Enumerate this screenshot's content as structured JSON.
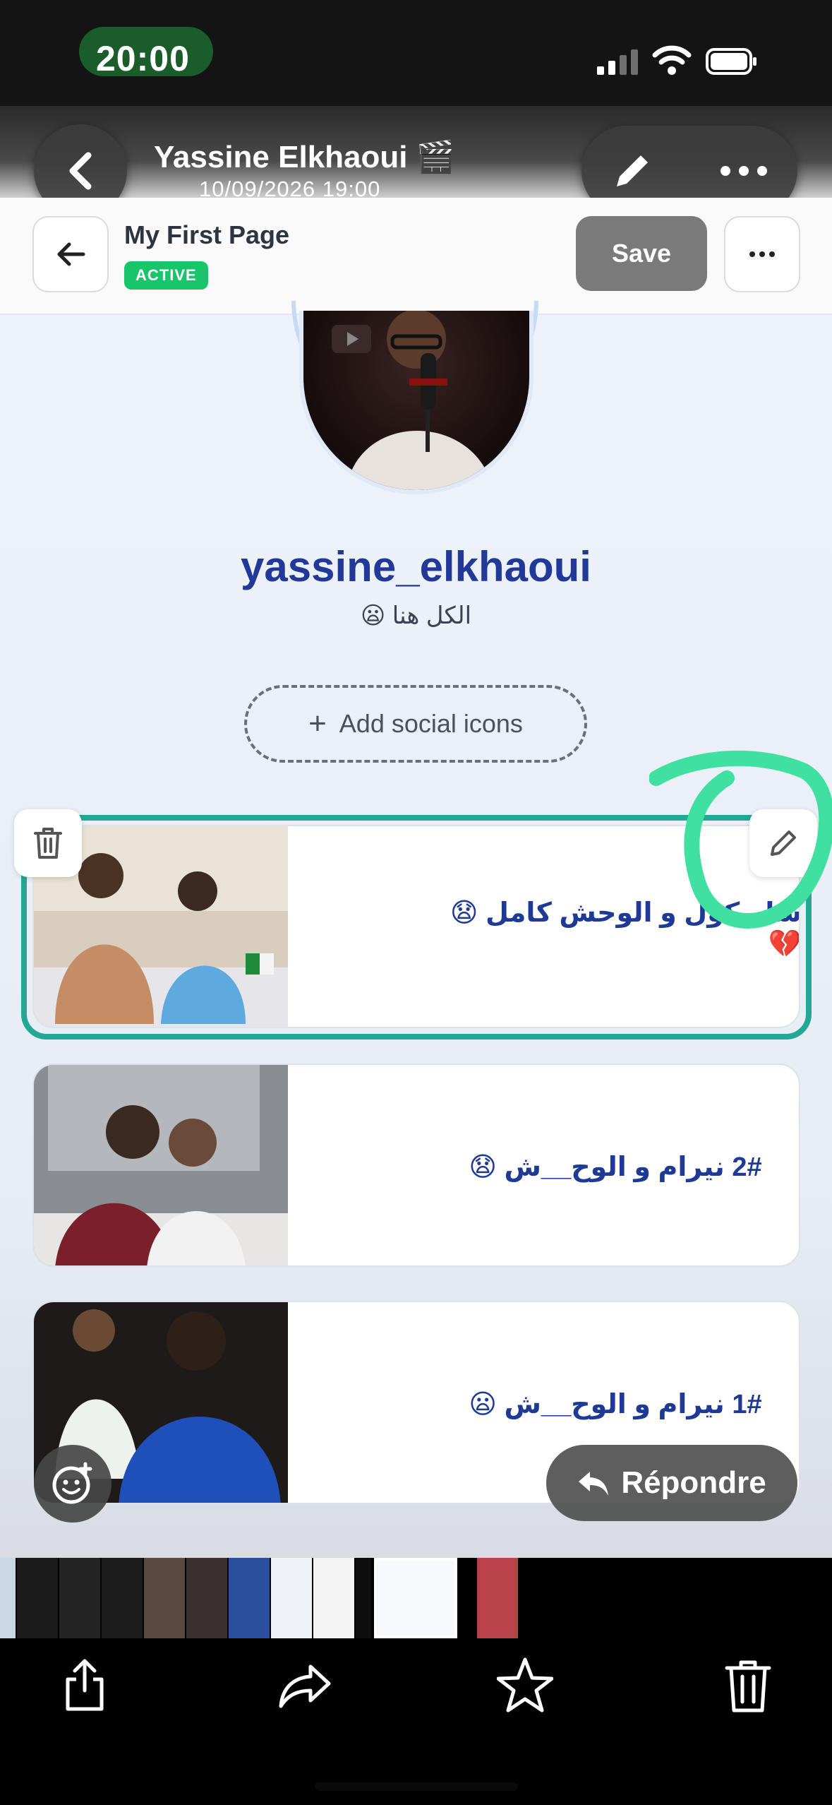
{
  "status_bar": {
    "time": "20:00"
  },
  "viewer": {
    "title": "Yassine Elkhaoui 🎬",
    "date": "10/09/2026 19:00",
    "reply_label": "Répondre"
  },
  "editor": {
    "page_name": "My First Page",
    "status_badge": "ACTIVE",
    "save_label": "Save"
  },
  "profile": {
    "username": "yassine_elkhaoui",
    "bio": "الكل هنا 😦",
    "add_social_label": "Add social icons"
  },
  "links": [
    {
      "title": "ساريكول و الوحش كامل 😧💔"
    },
    {
      "title": "2# نيرام و الوح__ش 😧"
    },
    {
      "title": "1# نيرام و الوح__ش 😦"
    }
  ],
  "colors": {
    "accent": "#23399a",
    "selection": "#23a894",
    "badge": "#18c56b",
    "annotation": "#3fe0a0"
  },
  "icons": {
    "viewer_back": "chevron-left-icon",
    "viewer_edit": "pencil-icon",
    "viewer_more": "ellipsis-icon",
    "editor_back": "arrow-left-icon",
    "delete": "trash-icon",
    "edit": "pencil-icon",
    "react": "emoji-plus-icon",
    "reply": "reply-arrow-icon",
    "share": "share-icon",
    "forward": "forward-icon",
    "star": "star-icon",
    "trash": "trash-icon"
  }
}
